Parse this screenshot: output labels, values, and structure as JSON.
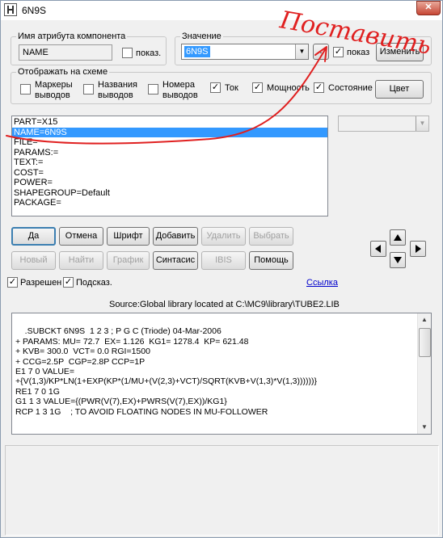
{
  "window": {
    "title": "6N9S"
  },
  "attr_name_group": {
    "legend": "Имя атрибута компонента",
    "value": "NAME",
    "show_label": "показ.",
    "show_checked": false
  },
  "value_group": {
    "legend": "Значение",
    "value": "6N9S",
    "browse_label": "...",
    "show_label": "показ",
    "show_checked": true,
    "change_label": "Изменить"
  },
  "display_group": {
    "legend": "Отображать на схеме",
    "items": [
      {
        "label_line1": "Маркеры",
        "label_line2": "выводов",
        "checked": false
      },
      {
        "label_line1": "Названия",
        "label_line2": "выводов",
        "checked": false
      },
      {
        "label_line1": "Номера",
        "label_line2": "выводов",
        "checked": false
      },
      {
        "label_line1": "Ток",
        "label_line2": "",
        "checked": true
      },
      {
        "label_line1": "Мощность",
        "label_line2": "",
        "checked": true
      },
      {
        "label_line1": "Состояние",
        "label_line2": "",
        "checked": true
      }
    ],
    "color_label": "Цвет"
  },
  "attributes_list": [
    "PART=X15",
    "NAME=6N9S",
    "FILE=",
    "PARAMS:=",
    "TEXT:=",
    "COST=",
    "POWER=",
    "SHAPEGROUP=Default",
    "PACKAGE="
  ],
  "selected_index": 1,
  "buttons_row1": [
    "Да",
    "Отмена",
    "Шрифт",
    "Добавить",
    "Удалить",
    "Выбрать"
  ],
  "buttons_row2": [
    "Новый",
    "Найти",
    "График",
    "Синтасис",
    "IBIS",
    "Помощь"
  ],
  "options": {
    "enabled_label": "Разрешен",
    "enabled_checked": true,
    "hint_label": "Подсказ.",
    "hint_checked": true,
    "link_label": "Ссылка"
  },
  "source_text": "Source:Global library located at C:\\MC9\\library\\TUBE2.LIB",
  "model_text": ".SUBCKT 6N9S  1 2 3 ; P G C (Triode) 04-Mar-2006\n+ PARAMS: MU= 72.7  EX= 1.126  KG1= 1278.4  KP= 621.48\n+ KVB= 300.0  VCT= 0.0 RGI=1500\n+ CCG=2.5P  CGP=2.8P CCP=1P\nE1 7 0 VALUE=\n+{V(1,3)/KP*LN(1+EXP(KP*(1/MU+(V(2,3)+VCT)/SQRT(KVB+V(1,3)*V(1,3))))))}\nRE1 7 0 1G\nG1 1 3 VALUE={(PWR(V(7),EX)+PWRS(V(7),EX))/KG1}\nRCP 1 3 1G    ; TO AVOID FLOATING NODES IN MU-FOLLOWER",
  "annotation": {
    "text": "Поставить",
    "color": "#e02020"
  }
}
